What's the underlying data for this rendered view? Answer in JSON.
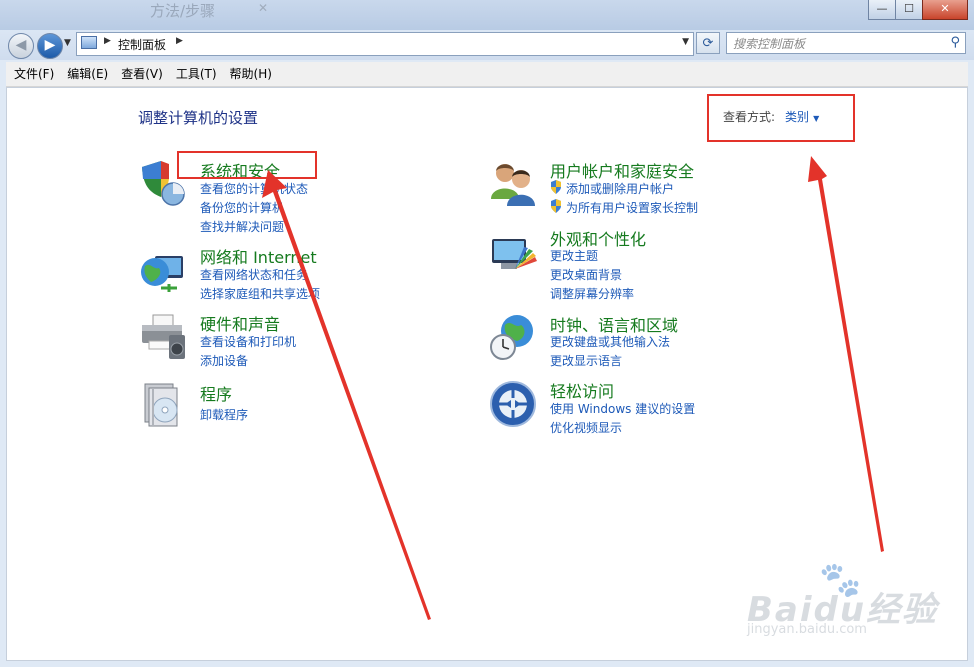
{
  "window": {
    "background_title": "方法/步骤",
    "controls": {
      "minimize": "—",
      "maximize": "☐",
      "close": "✕"
    }
  },
  "nav": {
    "back_glyph": "◀",
    "forward_glyph": "▶",
    "address": "控制面板",
    "search_placeholder": "搜索控制面板",
    "refresh_glyph": "⟳",
    "search_glyph": "⚲"
  },
  "menu": [
    "文件(F)",
    "编辑(E)",
    "查看(V)",
    "工具(T)",
    "帮助(H)"
  ],
  "main": {
    "heading": "调整计算机的设置",
    "view_by_label": "查看方式:",
    "view_by_value": "类别",
    "categories": [
      {
        "icon": "system-security-icon",
        "title": "系统和安全",
        "links": [
          "查看您的计算机状态",
          "备份您的计算机",
          "查找并解决问题"
        ]
      },
      {
        "icon": "network-globe-icon",
        "title": "网络和 Internet",
        "links": [
          "查看网络状态和任务",
          "选择家庭组和共享选项"
        ]
      },
      {
        "icon": "printer-speaker-icon",
        "title": "硬件和声音",
        "links": [
          "查看设备和打印机",
          "添加设备"
        ]
      },
      {
        "icon": "programs-cd-icon",
        "title": "程序",
        "links": [
          "卸载程序"
        ]
      },
      {
        "icon": "users-icon",
        "title": "用户帐户和家庭安全",
        "links": [
          "添加或删除用户帐户",
          "为所有用户设置家长控制"
        ]
      },
      {
        "icon": "appearance-monitor-icon",
        "title": "外观和个性化",
        "links": [
          "更改主题",
          "更改桌面背景",
          "调整屏幕分辨率"
        ]
      },
      {
        "icon": "clock-globe-icon",
        "title": "时钟、语言和区域",
        "links": [
          "更改键盘或其他输入法",
          "更改显示语言"
        ]
      },
      {
        "icon": "ease-of-access-icon",
        "title": "轻松访问",
        "links": [
          "使用 Windows 建议的设置",
          "优化视频显示"
        ]
      }
    ]
  },
  "annotations": {
    "color": "#e3332a"
  },
  "watermark": {
    "brand": "Baidu经验",
    "url": "jingyan.baidu.com"
  }
}
